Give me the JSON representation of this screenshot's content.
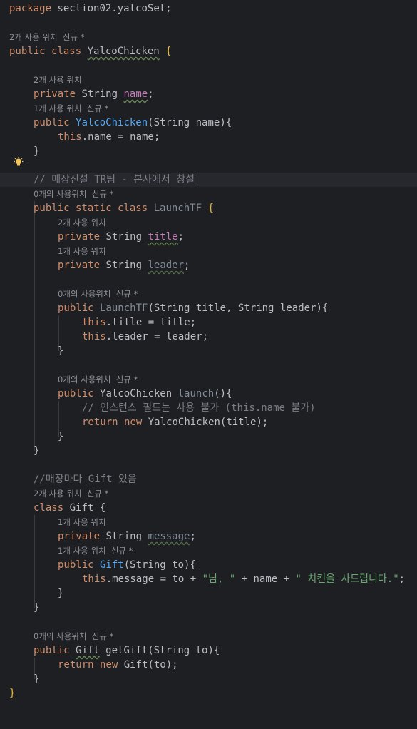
{
  "package": {
    "kw": "package",
    "name": "section02.yalcoSet;"
  },
  "hints": {
    "h1": "2개 사용 위치  신규 *",
    "h2": "2개 사용 위치",
    "h3": "1개 사용 위치  신규 *",
    "h4": "0개의 사용위치  신규 *",
    "h5": "2개 사용 위치",
    "h6": "1개 사용 위치",
    "h7": "0개의 사용위치  신규 *",
    "h8": "0개의 사용위치  신규 *",
    "h9": "2개 사용 위치  신규 *",
    "h10": "1개 사용 위치",
    "h11": "1개 사용 위치  신규 *",
    "h12": "0개의 사용위치  신규 *"
  },
  "code": {
    "l1_kw": "public class",
    "l1_name": "YalcoChicken",
    "l1_brace": " {",
    "private": "private",
    "public": "public",
    "string": "String",
    "name_field": "name",
    "semi": ";",
    "ctor_name": "YalcoChicken",
    "ctor_params": "(String name){",
    "this": "this",
    "assign_name": ".name = name;",
    "close": "}",
    "comment1": "// 매장신설 TR팀 - 본사에서 창설",
    "static_class": "public static class",
    "launch_class": "LaunchTF",
    "title": "title",
    "leader": "leader",
    "ctor2_name": "LaunchTF",
    "ctor2_params_a": "(String ",
    "ctor2_params_b": "title",
    "ctor2_params_c": ", String ",
    "ctor2_params_d": "leader",
    "ctor2_params_e": "){",
    "assign_title_a": ".title = title;",
    "assign_leader_a": ".leader = leader;",
    "launch_ret": "YalcoChicken",
    "launch_name": "launch",
    "launch_paren": "(){",
    "comment2": "// 인스턴스 필드는 사용 불가 (this.name 불가)",
    "return": "return",
    "new": "new",
    "ret_expr": "YalcoChicken(title);",
    "comment3": "//매장마다 Gift 있음",
    "class_kw": "class",
    "gift": "Gift",
    "gift_brace": " {",
    "message": "message",
    "gift_ctor_params": "(String to){",
    "msg_stmt_a": ".message = to + ",
    "str1": "\"님, \"",
    "plus_name": " + name + ",
    "str2": "\" 치킨을 사드립니다.\"",
    "semi2": ";",
    "getgift": "getGift",
    "getgift_params": "(String to){",
    "ret_gift": "Gift(to);"
  }
}
